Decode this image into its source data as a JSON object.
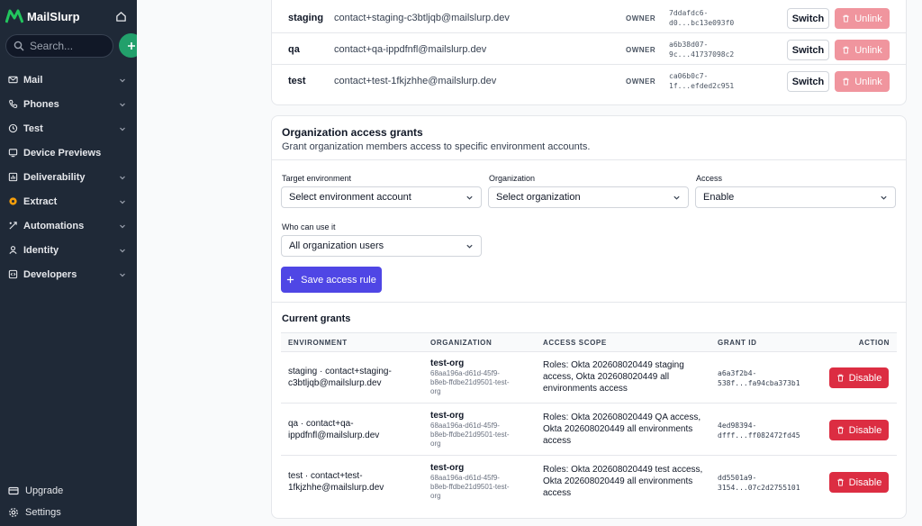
{
  "sidebar": {
    "brand": "MailSlurp",
    "search_placeholder": "Search...",
    "items": [
      {
        "label": "Mail",
        "icon": "mail-icon"
      },
      {
        "label": "Phones",
        "icon": "phone-icon"
      },
      {
        "label": "Test",
        "icon": "clock-icon"
      },
      {
        "label": "Device Previews",
        "icon": "device-icon"
      },
      {
        "label": "Deliverability",
        "icon": "chart-icon"
      },
      {
        "label": "Extract",
        "icon": "extract-icon"
      },
      {
        "label": "Automations",
        "icon": "automation-icon"
      },
      {
        "label": "Identity",
        "icon": "identity-icon"
      },
      {
        "label": "Developers",
        "icon": "code-icon"
      }
    ],
    "upgrade": "Upgrade",
    "settings": "Settings"
  },
  "environments": [
    {
      "name": "staging",
      "email": "contact+staging-c3btljqb@mailslurp.dev",
      "role": "OWNER",
      "id_line1": "7ddafdc6-",
      "id_line2": "d0...bc13e093f0",
      "switch_label": "Switch",
      "unlink_label": "Unlink"
    },
    {
      "name": "qa",
      "email": "contact+qa-ippdfnfl@mailslurp.dev",
      "role": "OWNER",
      "id_line1": "a6b38d07-",
      "id_line2": "9c...41737098c2",
      "switch_label": "Switch",
      "unlink_label": "Unlink"
    },
    {
      "name": "test",
      "email": "contact+test-1fkjzhhe@mailslurp.dev",
      "role": "OWNER",
      "id_line1": "ca06b0c7-",
      "id_line2": "1f...efded2c951",
      "switch_label": "Switch",
      "unlink_label": "Unlink"
    }
  ],
  "org_access": {
    "title": "Organization access grants",
    "subtitle": "Grant organization members access to specific environment accounts.",
    "target_label": "Target environment",
    "target_value": "Select environment account",
    "org_label": "Organization",
    "org_value": "Select organization",
    "access_label": "Access",
    "access_value": "Enable",
    "who_label": "Who can use it",
    "who_value": "All organization users",
    "save_label": "Save access rule"
  },
  "grants": {
    "title": "Current grants",
    "headers": [
      "ENVIRONMENT",
      "ORGANIZATION",
      "ACCESS SCOPE",
      "GRANT ID",
      "ACTION"
    ],
    "rows": [
      {
        "env_line1": "staging · contact+staging-",
        "env_line2": "c3btljqb@mailslurp.dev",
        "org_name": "test-org",
        "org_id_lines": [
          "68aa196a-d61d-45f9-",
          "b8eb-ffdbe21d9501-test-",
          "org"
        ],
        "scope_lines": [
          "Roles: Okta 202608020449 staging",
          "access, Okta 202608020449 all",
          "environments access"
        ],
        "grant_line1": "a6a3f2b4-",
        "grant_line2": "538f...fa94cba373b1",
        "action": "Disable"
      },
      {
        "env_line1": "qa · contact+qa-",
        "env_line2": "ippdfnfl@mailslurp.dev",
        "org_name": "test-org",
        "org_id_lines": [
          "68aa196a-d61d-45f9-",
          "b8eb-ffdbe21d9501-test-",
          "org"
        ],
        "scope_lines": [
          "Roles: Okta 202608020449 QA access,",
          "Okta 202608020449 all environments",
          "access"
        ],
        "grant_line1": "4ed98394-",
        "grant_line2": "dfff...ff082472fd45",
        "action": "Disable"
      },
      {
        "env_line1": "test · contact+test-",
        "env_line2": "1fkjzhhe@mailslurp.dev",
        "org_name": "test-org",
        "org_id_lines": [
          "68aa196a-d61d-45f9-",
          "b8eb-ffdbe21d9501-test-",
          "org"
        ],
        "scope_lines": [
          "Roles: Okta 202608020449 test access,",
          "Okta 202608020449 all environments",
          "access"
        ],
        "grant_line1": "dd5501a9-",
        "grant_line2": "3154...07c2d2755101",
        "action": "Disable"
      }
    ]
  },
  "colors": {
    "sidebar_bg": "#1f2937",
    "brand_green": "#22a06b",
    "primary": "#4f46e5",
    "danger": "#dc2d42",
    "danger_disabled": "#f0959e"
  }
}
